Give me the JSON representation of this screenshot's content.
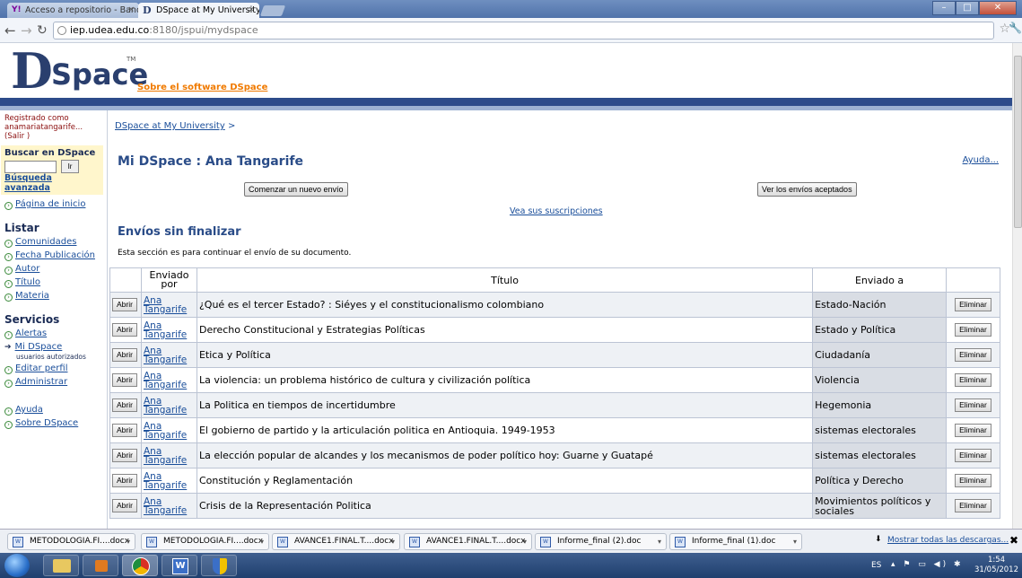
{
  "browser": {
    "tabs": [
      {
        "label": "Acceso a repositorio - Band",
        "icon": "yahoo-icon"
      },
      {
        "label": "DSpace at My University: M",
        "icon": "dspace-icon"
      }
    ],
    "address": {
      "host": "iep.udea.edu.co",
      "path": ":8180/jspui/mydspace"
    }
  },
  "banner": {
    "logo_d": "D",
    "logo_space": "Space",
    "logo_tm": "TM",
    "about_link": "Sobre el software DSpace"
  },
  "sidebar": {
    "registered_line1": "Registrado como",
    "registered_line2": "anamariatangarife...",
    "logout": "(Salir )",
    "search_heading": "Buscar en DSpace",
    "search_button": "Ir",
    "advanced_search": "Búsqueda avanzada",
    "home": "Página de inicio",
    "list_heading": "Listar",
    "list_items": [
      "Comunidades",
      "Fecha Publicación",
      "Autor",
      "Título",
      "Materia"
    ],
    "services_heading": "Servicios",
    "services": {
      "alerts": "Alertas",
      "mydspace": "Mi DSpace",
      "mydspace_sub": "usuarios autorizados",
      "edit_profile": "Editar perfil",
      "admin": "Administrar"
    },
    "help": "Ayuda",
    "about": "Sobre DSpace"
  },
  "main": {
    "breadcrumb": "DSpace at My University",
    "breadcrumb_sep": ">",
    "title": "Mi DSpace : Ana Tangarife",
    "help": "Ayuda...",
    "new_submission_button": "Comenzar un nuevo envío",
    "accepted_button": "Ver los envíos aceptados",
    "subscriptions_link": "Vea sus suscripciones",
    "section_title": "Envíos sin finalizar",
    "section_desc": "Esta sección es para continuar el envío de su documento.",
    "table": {
      "headers": {
        "submitted_by": "Enviado por",
        "title": "Título",
        "sent_to": "Enviado a"
      },
      "open_label": "Abrir",
      "remove_label": "Eliminar",
      "rows": [
        {
          "by1": "Ana",
          "by2": "Tangarife",
          "title": "¿Qué es el tercer Estado? : Siéyes y el constitucionalismo colombiano",
          "to": "Estado-Nación"
        },
        {
          "by1": "Ana",
          "by2": "Tangarife",
          "title": "Derecho Constitucional y Estrategias Políticas",
          "to": "Estado y Política"
        },
        {
          "by1": "Ana",
          "by2": "Tangarife",
          "title": "Etica y Política",
          "to": "Ciudadanía"
        },
        {
          "by1": "Ana",
          "by2": "Tangarife",
          "title": "La violencia: un problema histórico de cultura y civilización política",
          "to": "Violencia"
        },
        {
          "by1": "Ana",
          "by2": "Tangarife",
          "title": "La Politica en tiempos de incertidumbre",
          "to": "Hegemonia"
        },
        {
          "by1": "Ana",
          "by2": "Tangarife",
          "title": "El gobierno de partido y la articulación politica en Antioquia. 1949-1953",
          "to": "sistemas electorales"
        },
        {
          "by1": "Ana",
          "by2": "Tangarife",
          "title": "La elección popular de alcandes y los mecanismos de poder político hoy: Guarne y Guatapé",
          "to": "sistemas electorales"
        },
        {
          "by1": "Ana",
          "by2": "Tangarife",
          "title": "Constitución y Reglamentación",
          "to": "Política y Derecho"
        },
        {
          "by1": "Ana",
          "by2": "Tangarife",
          "title": "Crisis de la Representación Politica",
          "to": "Movimientos políticos y sociales"
        }
      ]
    }
  },
  "downloads": {
    "items": [
      "METODOLOGIA.FI....docx",
      "METODOLOGIA.FI....docx",
      "AVANCE1.FINAL.T....docx",
      "AVANCE1.FINAL.T....docx",
      "Informe_final (2).doc",
      "Informe_final (1).doc"
    ],
    "show_all": "Mostrar todas las descargas...",
    "close": "✖"
  },
  "taskbar": {
    "lang": "ES",
    "time": "1:54",
    "date": "31/05/2012"
  },
  "colors": {
    "accent": "#2a4c88",
    "link": "#1a4e9a",
    "banner_bar": "#2d4b8a",
    "about_link": "#f07a00"
  }
}
